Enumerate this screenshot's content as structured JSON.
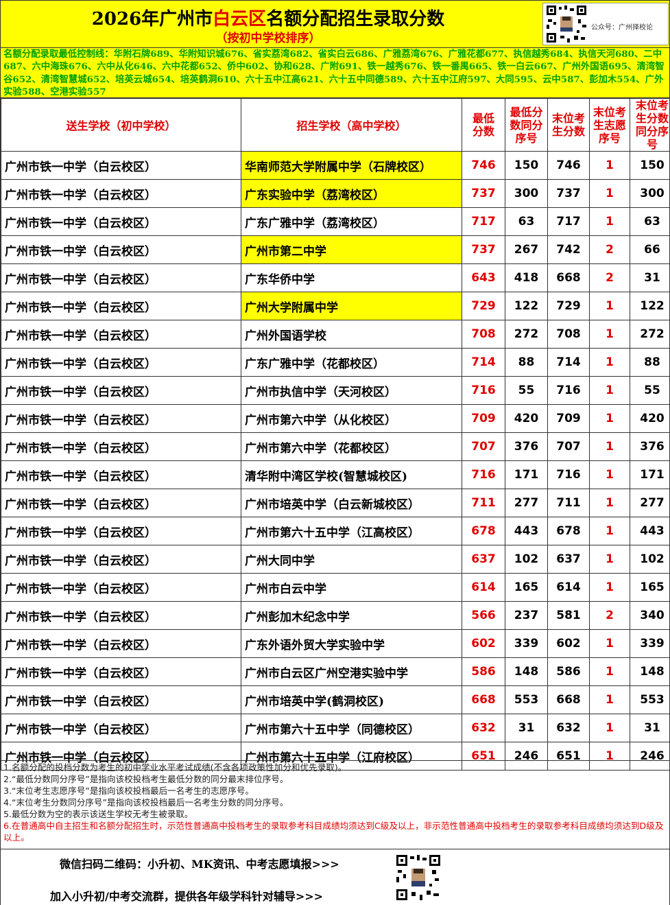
{
  "header": {
    "title_pre": "2026年广州市",
    "title_red": "白云区",
    "title_post": "名额分配招生录取分数",
    "subtitle": "（按初中学校排序）",
    "qr_label": "公众号：广州择校论"
  },
  "control_text": "名额分配录取最低控制线：华附石牌689、华附知识城676、省实荔湾682、省实白云686、广雅荔湾676、广雅花都677、执信越秀684、执信天河680、二中687、六中海珠676、六中从化646、六中花都652、侨中602、协和628、广附691、铁一越秀676、铁一番禺665、铁一白云667、广州外国语695、清湾智谷652、清湾智慧城652、培英云城654、培英鹤洞610、六十五中江高621、六十五中同德589、六十五中江府597、大同595、云中587、彭加木554、广外实验588、空港实验557",
  "columns": {
    "send": "送生学校（初中学校）",
    "recv": "招生学校（高中学校）",
    "min_score": "最低分数",
    "min_rank": "最低分数同分序号",
    "last_score": "末位考生分数",
    "last_vol": "末位考生志愿序号",
    "last_rank": "末位考生分数同分序号"
  },
  "rows": [
    {
      "send": "广州市铁一中学（白云校区）",
      "recv": "华南师范大学附属中学（石牌校区）",
      "hl": true,
      "score": "746",
      "rank": "150",
      "last": "746",
      "vol": "1",
      "lrank": "150"
    },
    {
      "send": "广州市铁一中学（白云校区）",
      "recv": "广东实验中学（荔湾校区）",
      "hl": true,
      "score": "737",
      "rank": "300",
      "last": "737",
      "vol": "1",
      "lrank": "300"
    },
    {
      "send": "广州市铁一中学（白云校区）",
      "recv": "广东广雅中学（荔湾校区）",
      "hl": false,
      "score": "717",
      "rank": "63",
      "last": "717",
      "vol": "1",
      "lrank": "63"
    },
    {
      "send": "广州市铁一中学（白云校区）",
      "recv": "广州市第二中学",
      "hl": true,
      "score": "737",
      "rank": "267",
      "last": "742",
      "vol": "2",
      "lrank": "66"
    },
    {
      "send": "广州市铁一中学（白云校区）",
      "recv": "广东华侨中学",
      "hl": false,
      "score": "643",
      "rank": "418",
      "last": "668",
      "vol": "2",
      "lrank": "31"
    },
    {
      "send": "广州市铁一中学（白云校区）",
      "recv": "广州大学附属中学",
      "hl": true,
      "score": "729",
      "rank": "122",
      "last": "729",
      "vol": "1",
      "lrank": "122"
    },
    {
      "send": "广州市铁一中学（白云校区）",
      "recv": "广州外国语学校",
      "hl": false,
      "score": "708",
      "rank": "272",
      "last": "708",
      "vol": "1",
      "lrank": "272"
    },
    {
      "send": "广州市铁一中学（白云校区）",
      "recv": "广东广雅中学（花都校区）",
      "hl": false,
      "score": "714",
      "rank": "88",
      "last": "714",
      "vol": "1",
      "lrank": "88"
    },
    {
      "send": "广州市铁一中学（白云校区）",
      "recv": "广州市执信中学（天河校区）",
      "hl": false,
      "score": "716",
      "rank": "55",
      "last": "716",
      "vol": "1",
      "lrank": "55"
    },
    {
      "send": "广州市铁一中学（白云校区）",
      "recv": "广州市第六中学（从化校区）",
      "hl": false,
      "score": "709",
      "rank": "420",
      "last": "709",
      "vol": "1",
      "lrank": "420"
    },
    {
      "send": "广州市铁一中学（白云校区）",
      "recv": "广州市第六中学（花都校区）",
      "hl": false,
      "score": "707",
      "rank": "376",
      "last": "707",
      "vol": "1",
      "lrank": "376"
    },
    {
      "send": "广州市铁一中学（白云校区）",
      "recv": "清华附中湾区学校(智慧城校区)",
      "hl": false,
      "score": "716",
      "rank": "171",
      "last": "716",
      "vol": "1",
      "lrank": "171"
    },
    {
      "send": "广州市铁一中学（白云校区）",
      "recv": "广州市培英中学（白云新城校区）",
      "hl": false,
      "score": "711",
      "rank": "277",
      "last": "711",
      "vol": "1",
      "lrank": "277"
    },
    {
      "send": "广州市铁一中学（白云校区）",
      "recv": "广州市第六十五中学（江高校区）",
      "hl": false,
      "score": "678",
      "rank": "443",
      "last": "678",
      "vol": "1",
      "lrank": "443"
    },
    {
      "send": "广州市铁一中学（白云校区）",
      "recv": "广州大同中学",
      "hl": false,
      "score": "637",
      "rank": "102",
      "last": "637",
      "vol": "1",
      "lrank": "102"
    },
    {
      "send": "广州市铁一中学（白云校区）",
      "recv": "广州市白云中学",
      "hl": false,
      "score": "614",
      "rank": "165",
      "last": "614",
      "vol": "1",
      "lrank": "165"
    },
    {
      "send": "广州市铁一中学（白云校区）",
      "recv": "广州彭加木纪念中学",
      "hl": false,
      "score": "566",
      "rank": "237",
      "last": "581",
      "vol": "2",
      "lrank": "340"
    },
    {
      "send": "广州市铁一中学（白云校区）",
      "recv": "广东外语外贸大学实验中学",
      "hl": false,
      "score": "602",
      "rank": "339",
      "last": "602",
      "vol": "1",
      "lrank": "339"
    },
    {
      "send": "广州市铁一中学（白云校区）",
      "recv": "广州市白云区广州空港实验中学",
      "hl": false,
      "score": "586",
      "rank": "148",
      "last": "586",
      "vol": "1",
      "lrank": "148"
    },
    {
      "send": "广州市铁一中学（白云校区）",
      "recv": "广州市培英中学(鹤洞校区)",
      "hl": false,
      "score": "668",
      "rank": "553",
      "last": "668",
      "vol": "1",
      "lrank": "553"
    },
    {
      "send": "广州市铁一中学（白云校区）",
      "recv": "广州市第六十五中学（同德校区）",
      "hl": false,
      "score": "632",
      "rank": "31",
      "last": "632",
      "vol": "1",
      "lrank": "31"
    },
    {
      "send": "广州市铁一中学（白云校区）",
      "recv": "广州市第六十五中学（江府校区）",
      "hl": false,
      "score": "651",
      "rank": "246",
      "last": "651",
      "vol": "1",
      "lrank": "246"
    }
  ],
  "notes": [
    "1.名额分配的投档分数为考生的初中学业水平考试成绩(不含各项政策性加分和优先录取)。",
    "2.“最低分数同分序号”是指向该校投档考生最低分数的同分最末排位序号。",
    "3.“末位考生志愿序号”是指向该校投档最后一名考生的志愿序号。",
    "4.“末位考生分数同分序号”是指向该校投档最后一名考生分数的同分序号。",
    "5.最低分数为空的表示该送生学校无考生被录取。",
    "6.在普通高中自主招生和名额分配招生时，示范性普通高中投档考生的录取参考科目成绩均须达到C级及以上，非示范性普通高中投档考生的录取参考科目成绩均须达到D级及以上。"
  ],
  "footer": {
    "line1": "微信扫码二维码：小升初、MK资讯、中考志愿填报>>>",
    "line2": "加入小升初/中考交流群，提供各年级学科针对辅导>>>"
  }
}
